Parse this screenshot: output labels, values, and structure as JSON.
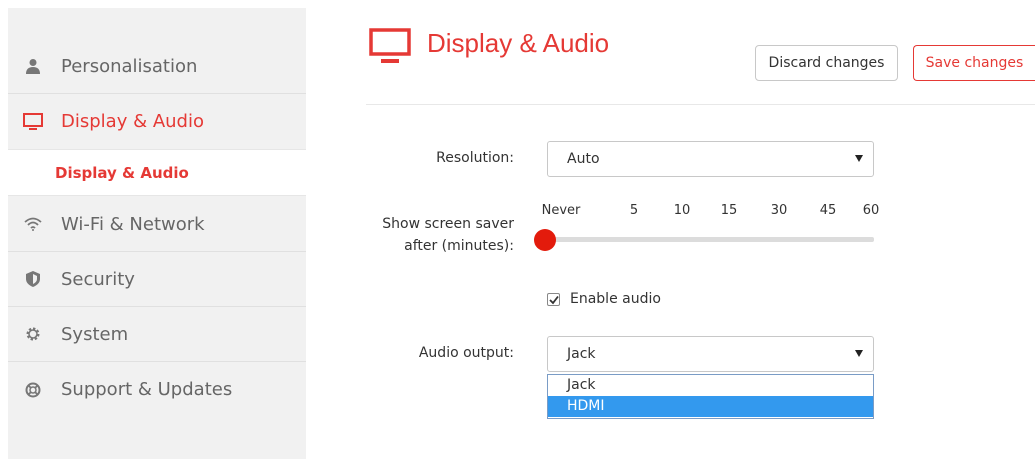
{
  "colors": {
    "accent": "#e53935",
    "highlight": "#3399ee"
  },
  "sidebar": {
    "items": [
      {
        "label": "Personalisation",
        "icon": "person-icon"
      },
      {
        "label": "Display & Audio",
        "icon": "monitor-icon",
        "active": true
      },
      {
        "label": "Wi-Fi & Network",
        "icon": "wifi-icon"
      },
      {
        "label": "Security",
        "icon": "shield-icon"
      },
      {
        "label": "System",
        "icon": "gear-icon"
      },
      {
        "label": "Support & Updates",
        "icon": "lifebuoy-icon"
      }
    ],
    "sub_item": "Display & Audio"
  },
  "header": {
    "title": "Display & Audio",
    "icon": "monitor-icon",
    "discard_label": "Discard changes",
    "save_label": "Save changes"
  },
  "form": {
    "resolution_label": "Resolution:",
    "resolution_value": "Auto",
    "saver_label_line1": "Show screen saver",
    "saver_label_line2": "after (minutes):",
    "saver_ticks": [
      "Never",
      "5",
      "10",
      "15",
      "30",
      "45",
      "60"
    ],
    "saver_value": "Never",
    "audio_checkbox_label": "Enable audio",
    "audio_enabled": true,
    "audio_output_label": "Audio output:",
    "audio_output_value": "Jack",
    "audio_options": [
      "Jack",
      "HDMI"
    ],
    "audio_highlighted": "HDMI"
  }
}
